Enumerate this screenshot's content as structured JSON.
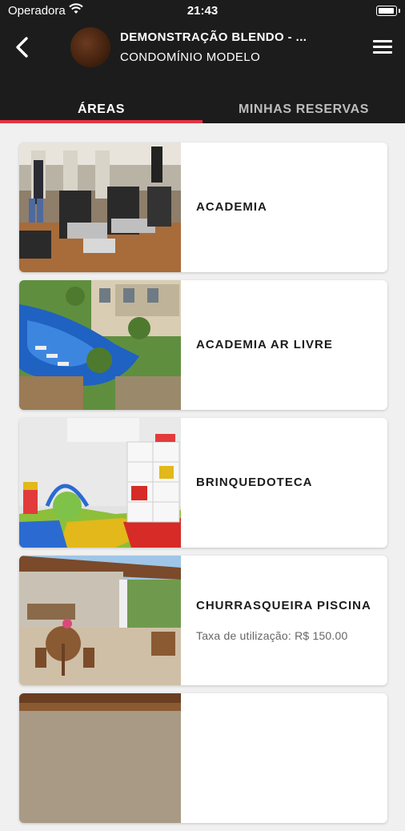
{
  "status_bar": {
    "carrier": "Operadora",
    "time": "21:43"
  },
  "header": {
    "title": "DEMONSTRAÇÃO BLENDO - ...",
    "subtitle": "CONDOMÍNIO MODELO",
    "back_icon": "chevron-left-icon",
    "menu_icon": "hamburger-menu-icon"
  },
  "tabs": [
    {
      "label": "ÁREAS",
      "active": true
    },
    {
      "label": "MINHAS RESERVAS",
      "active": false
    }
  ],
  "colors": {
    "header_bg": "#1c1c1c",
    "accent": "#e53342",
    "page_bg": "#f0f0f0"
  },
  "areas": [
    {
      "name": "ACADEMIA",
      "fee": ""
    },
    {
      "name": "ACADEMIA AR LIVRE",
      "fee": ""
    },
    {
      "name": "BRINQUEDOTECA",
      "fee": ""
    },
    {
      "name": "CHURRASQUEIRA PISCINA",
      "fee": "Taxa de utilização: R$ 150.00"
    },
    {
      "name": "",
      "fee": ""
    }
  ]
}
